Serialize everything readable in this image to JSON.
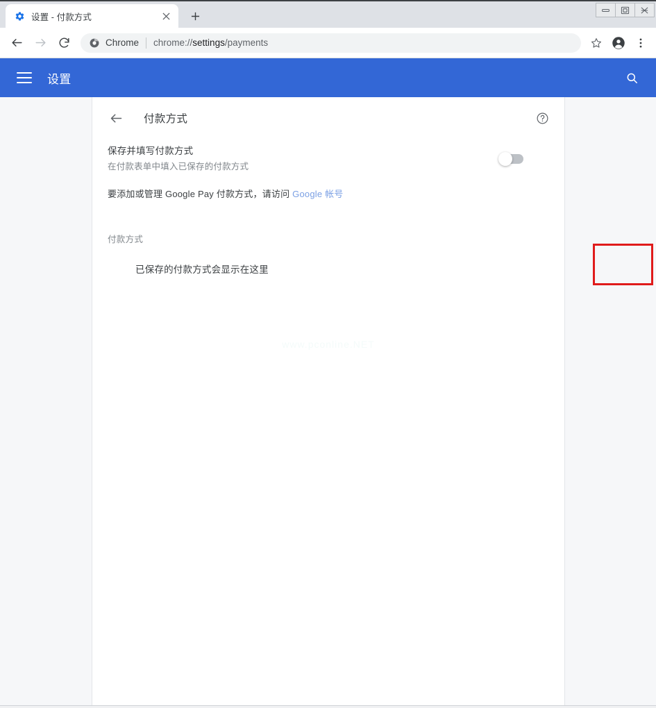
{
  "browser": {
    "tab": {
      "favicon": "settings-gear-icon",
      "title": "设置 - 付款方式",
      "close_label": "✕"
    },
    "new_tab_label": "+",
    "window_controls": {
      "minimize": "minimize-icon",
      "maximize": "maximize-icon",
      "close": "close-icon"
    },
    "toolbar": {
      "back": "back-icon",
      "forward": "forward-icon",
      "reload": "reload-icon",
      "omnibox": {
        "security_icon": "chrome-icon",
        "scheme_label": "Chrome",
        "url_prefix": "chrome://",
        "url_host": "settings",
        "url_path": "/payments",
        "full_url": "chrome://settings/payments"
      },
      "bookmark": "star-icon",
      "profile": "account-avatar-icon",
      "menu": "three-dot-menu-icon"
    }
  },
  "settings_header": {
    "menu_icon": "hamburger-menu-icon",
    "title": "设置",
    "search_icon": "search-icon"
  },
  "page": {
    "back_icon": "back-arrow-icon",
    "title": "付款方式",
    "help_icon": "help-circle-icon",
    "toggle": {
      "title": "保存并填写付款方式",
      "subtitle": "在付款表单中填入已保存的付款方式",
      "state": "off",
      "highlight_color": "#e01b1b"
    },
    "gpay": {
      "text_before": "要添加或管理 Google Pay 付款方式，请访问 ",
      "link_text": "Google 帐号"
    },
    "section_label": "付款方式",
    "empty_message": "已保存的付款方式会显示在这里",
    "watermark": "www.pconline.NET"
  },
  "colors": {
    "accent_blue": "#3367d6",
    "link_blue": "#7ba0e4",
    "highlight_red": "#e01b1b",
    "tabstrip_bg": "#dee1e6"
  }
}
